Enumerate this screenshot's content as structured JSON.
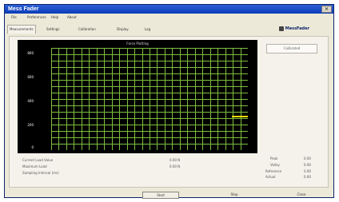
{
  "window": {
    "title": "Mess Fader",
    "close_glyph": "✕"
  },
  "menu": [
    "File",
    "Preferences",
    "Help",
    "About"
  ],
  "tabs": [
    "Measurements",
    "Settings",
    "Calibration",
    "Display",
    "Log"
  ],
  "logo": {
    "text": "MessFader",
    "icon": "logo-icon"
  },
  "graph": {
    "title": "Force Plotting",
    "y_labels": [
      "800",
      "600",
      "400",
      "200",
      "0"
    ],
    "grid_color": "#7fbf3f",
    "trace_color": "#ffdd00"
  },
  "sidebar": {
    "box_label": "Calibrated"
  },
  "stats_left": [
    "Current Load Value",
    "Maximum Load",
    "Sampling Interval (ms)"
  ],
  "stats_mid": [
    "0.00 N",
    "0.00 N"
  ],
  "stats_right_labels": [
    "Peak",
    "Valley",
    "Reference",
    "Actual"
  ],
  "stats_right_values": [
    "0.00",
    "0.00",
    "0.00",
    "0.00"
  ],
  "buttons": [
    "Start",
    "Stop",
    "Close"
  ]
}
